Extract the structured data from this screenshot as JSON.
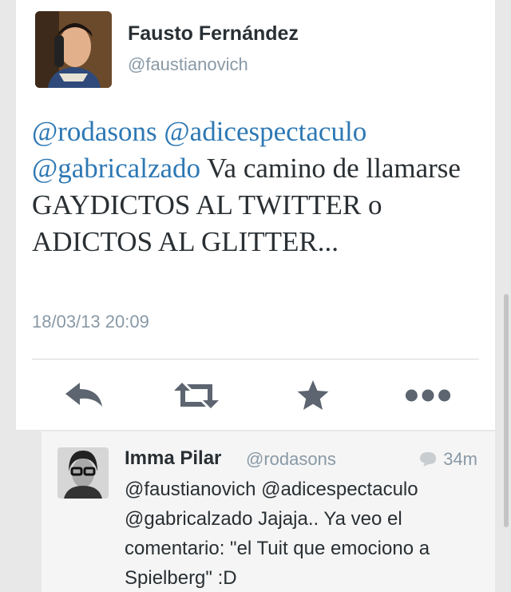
{
  "tweet": {
    "author_name": "Fausto Fernández",
    "author_handle": "@faustianovich",
    "mentions": [
      "@rodasons",
      "@adicespectaculo",
      "@gabricalzado"
    ],
    "body": " Va camino de llamarse GAYDICTOS AL TWITTER o ADICTOS AL GLITTER...",
    "timestamp": "18/03/13 20:09"
  },
  "actions": {
    "icons": [
      "reply-icon",
      "retweet-icon",
      "favorite-star-icon",
      "more-dots-icon"
    ]
  },
  "reply": {
    "author_name": "Imma Pilar",
    "author_handle": "@rodasons",
    "time_ago": "34m",
    "text": "@faustianovich @adicespectaculo @gabricalzado Jajaja.. Ya veo el comentario: \"el Tuit que emociono a Spielberg\" :D"
  },
  "colors": {
    "mention": "#2d78b4",
    "secondary_text": "#8899a6",
    "action_icon": "#5c6570"
  }
}
